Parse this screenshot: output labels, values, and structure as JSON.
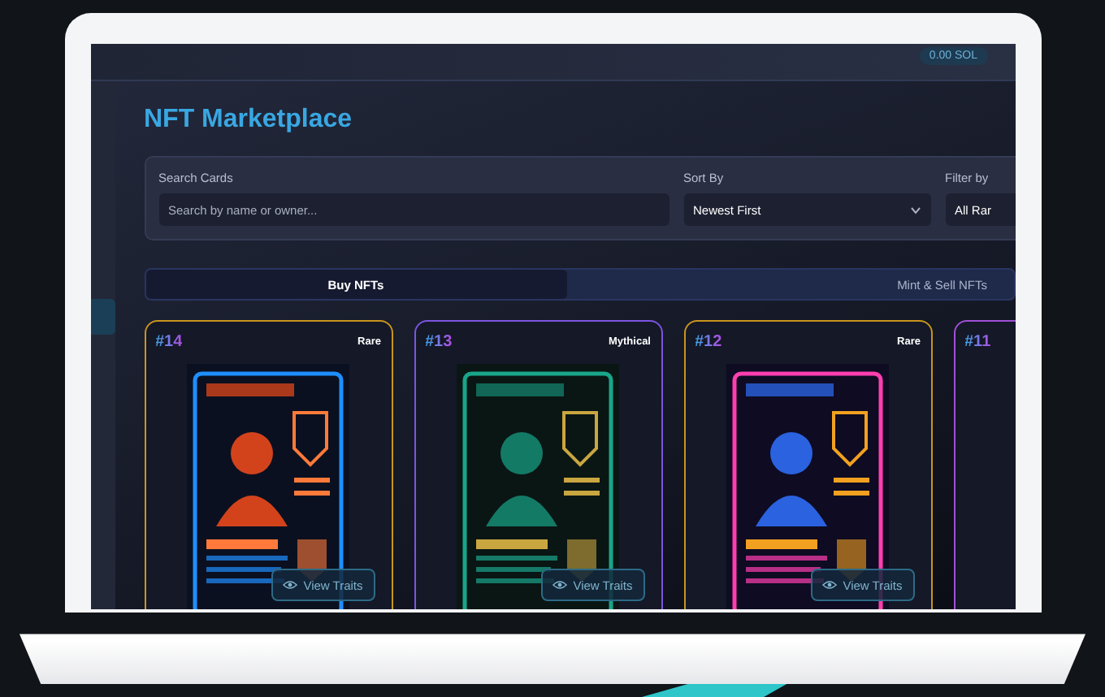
{
  "wallet": {
    "balance": "0.00 SOL"
  },
  "title": "NFT Marketplace",
  "filters": {
    "search": {
      "label": "Search Cards",
      "placeholder": "Search by name or owner..."
    },
    "sort": {
      "label": "Sort By",
      "value": "Newest First"
    },
    "rarity": {
      "label": "Filter by",
      "value": "All Rar"
    }
  },
  "tabs": [
    {
      "label": "Buy NFTs",
      "selected": true
    },
    {
      "label": "Mint & Sell NFTs",
      "selected": false
    }
  ],
  "cards": [
    {
      "number": "#14",
      "rarity": "Rare",
      "color": "#c9951c",
      "button": "View Traits"
    },
    {
      "number": "#13",
      "rarity": "Mythical",
      "color": "#7b55e0",
      "button": "View Traits"
    },
    {
      "number": "#12",
      "rarity": "Rare",
      "color": "#c9951c",
      "button": "View Traits"
    },
    {
      "number": "#11",
      "color": "#a14fd6"
    }
  ]
}
